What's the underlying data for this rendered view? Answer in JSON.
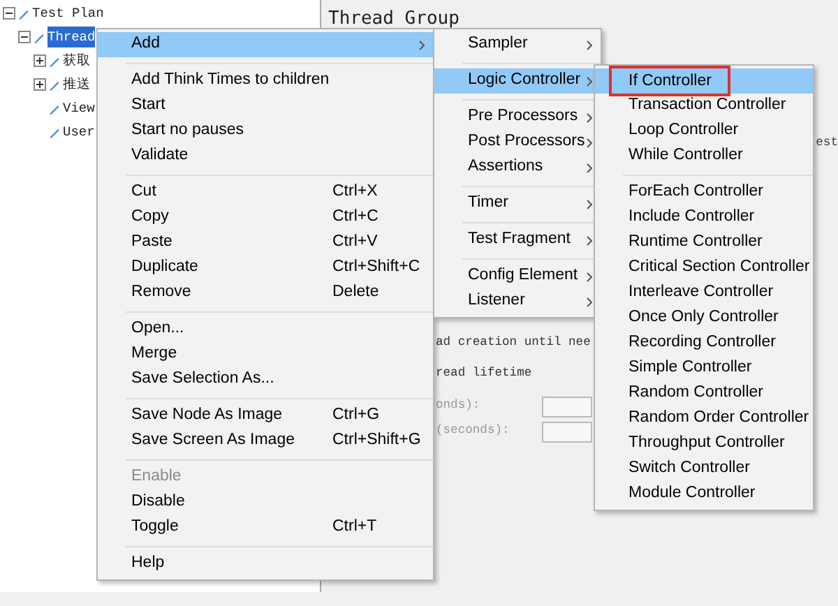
{
  "tree": [
    {
      "label": "Test Plan",
      "selected": false,
      "expanded": true,
      "children": [
        {
          "label": "Thread",
          "selected": true,
          "expanded": true,
          "children": [
            {
              "label": "获取",
              "selected": false,
              "expanded": false
            },
            {
              "label": "推送",
              "selected": false,
              "expanded": false
            },
            {
              "label": "View",
              "selected": false
            },
            {
              "label": "User",
              "selected": false
            }
          ]
        }
      ]
    }
  ],
  "panel": {
    "title": "Thread Group",
    "text_1": "est",
    "text_2": "ad creation until nee",
    "text_3": "read lifetime",
    "field_label_1": "onds):",
    "field_label_2": "(seconds):"
  },
  "context_menu": {
    "groups": [
      [
        {
          "label": "Add",
          "selected": true,
          "disabled": false,
          "submenu": true
        }
      ],
      [
        {
          "label": "Add Think Times to children",
          "selected": false,
          "disabled": false,
          "submenu": false
        },
        {
          "label": "Start",
          "selected": false,
          "disabled": false,
          "submenu": false
        },
        {
          "label": "Start no pauses",
          "selected": false,
          "disabled": false,
          "submenu": false
        },
        {
          "label": "Validate",
          "selected": false,
          "disabled": false,
          "submenu": false
        }
      ],
      [
        {
          "label": "Cut",
          "shortcut": "Ctrl+X",
          "selected": false,
          "disabled": false,
          "submenu": false
        },
        {
          "label": "Copy",
          "shortcut": "Ctrl+C",
          "selected": false,
          "disabled": false,
          "submenu": false
        },
        {
          "label": "Paste",
          "shortcut": "Ctrl+V",
          "selected": false,
          "disabled": false,
          "submenu": false
        },
        {
          "label": "Duplicate",
          "shortcut": "Ctrl+Shift+C",
          "selected": false,
          "disabled": false,
          "submenu": false
        },
        {
          "label": "Remove",
          "shortcut": "Delete",
          "selected": false,
          "disabled": false,
          "submenu": false
        }
      ],
      [
        {
          "label": "Open...",
          "selected": false,
          "disabled": false,
          "submenu": false
        },
        {
          "label": "Merge",
          "selected": false,
          "disabled": false,
          "submenu": false
        },
        {
          "label": "Save Selection As...",
          "selected": false,
          "disabled": false,
          "submenu": false
        }
      ],
      [
        {
          "label": "Save Node As Image",
          "shortcut": "Ctrl+G",
          "selected": false,
          "disabled": false,
          "submenu": false
        },
        {
          "label": "Save Screen As Image",
          "shortcut": "Ctrl+Shift+G",
          "selected": false,
          "disabled": false,
          "submenu": false
        }
      ],
      [
        {
          "label": "Enable",
          "selected": false,
          "disabled": true,
          "submenu": false
        },
        {
          "label": "Disable",
          "selected": false,
          "disabled": false,
          "submenu": false
        },
        {
          "label": "Toggle",
          "shortcut": "Ctrl+T",
          "selected": false,
          "disabled": false,
          "submenu": false
        }
      ],
      [
        {
          "label": "Help",
          "selected": false,
          "disabled": false,
          "submenu": false
        }
      ]
    ]
  },
  "add_menu": {
    "groups": [
      [
        {
          "label": "Sampler",
          "selected": false,
          "submenu": true
        }
      ],
      [
        {
          "label": "Logic Controller",
          "selected": true,
          "submenu": true
        }
      ],
      [
        {
          "label": "Pre Processors",
          "selected": false,
          "submenu": true
        },
        {
          "label": "Post Processors",
          "selected": false,
          "submenu": true
        },
        {
          "label": "Assertions",
          "selected": false,
          "submenu": true
        }
      ],
      [
        {
          "label": "Timer",
          "selected": false,
          "submenu": true
        }
      ],
      [
        {
          "label": "Test Fragment",
          "selected": false,
          "submenu": true
        }
      ],
      [
        {
          "label": "Config Element",
          "selected": false,
          "submenu": true
        },
        {
          "label": "Listener",
          "selected": false,
          "submenu": true
        }
      ]
    ]
  },
  "logic_controller_menu": {
    "groups": [
      [
        {
          "label": "If Controller",
          "selected": true,
          "boxed": true
        },
        {
          "label": "Transaction Controller",
          "selected": false,
          "boxed": false
        },
        {
          "label": "Loop Controller",
          "selected": false,
          "boxed": false
        },
        {
          "label": "While Controller",
          "selected": false,
          "boxed": false
        }
      ],
      [
        {
          "label": "ForEach Controller",
          "selected": false,
          "boxed": false
        },
        {
          "label": "Include Controller",
          "selected": false,
          "boxed": false
        },
        {
          "label": "Runtime Controller",
          "selected": false,
          "boxed": false
        },
        {
          "label": "Critical Section Controller",
          "selected": false,
          "boxed": false
        },
        {
          "label": "Interleave Controller",
          "selected": false,
          "boxed": false
        },
        {
          "label": "Once Only Controller",
          "selected": false,
          "boxed": false
        },
        {
          "label": "Recording Controller",
          "selected": false,
          "boxed": false
        },
        {
          "label": "Simple Controller",
          "selected": false,
          "boxed": false
        },
        {
          "label": "Random Controller",
          "selected": false,
          "boxed": false
        },
        {
          "label": "Random Order Controller",
          "selected": false,
          "boxed": false
        },
        {
          "label": "Throughput Controller",
          "selected": false,
          "boxed": false
        },
        {
          "label": "Switch Controller",
          "selected": false,
          "boxed": false
        },
        {
          "label": "Module Controller",
          "selected": false,
          "boxed": false
        }
      ]
    ]
  }
}
